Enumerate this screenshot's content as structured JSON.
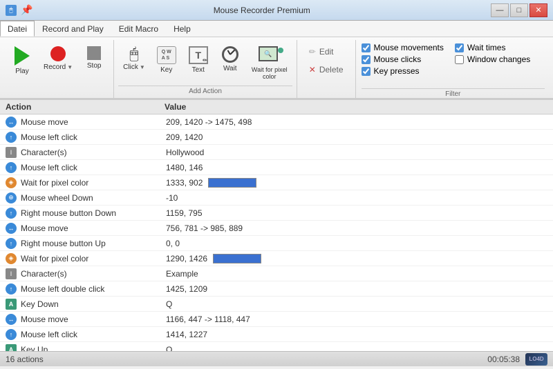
{
  "title": "Mouse Recorder Premium",
  "titlebar": {
    "icon": "🖱",
    "minimize": "—",
    "maximize": "□",
    "close": "✕"
  },
  "menu": {
    "items": [
      "Datei",
      "Record and Play",
      "Edit Macro",
      "Help"
    ],
    "active": "Datei"
  },
  "toolbar": {
    "play_label": "Play",
    "record_label": "Record",
    "stop_label": "Stop",
    "click_label": "Click",
    "key_label": "Key",
    "text_label": "Text",
    "wait_label": "Wait",
    "wait_pixel_label": "Wait for pixel color",
    "add_action_label": "Add Action",
    "edit_label": "Edit",
    "delete_label": "Delete",
    "filter_label": "Filter"
  },
  "filter": {
    "mouse_movements": {
      "label": "Mouse movements",
      "checked": true
    },
    "wait_times": {
      "label": "Wait times",
      "checked": true
    },
    "mouse_clicks": {
      "label": "Mouse clicks",
      "checked": true
    },
    "window_changes": {
      "label": "Window changes",
      "checked": false
    },
    "key_presses": {
      "label": "Key presses",
      "checked": true
    }
  },
  "table": {
    "col_action": "Action",
    "col_value": "Value",
    "rows": [
      {
        "icon_type": "blue",
        "icon_text": "↕",
        "action": "Mouse move",
        "value": "209, 1420 -> 1475, 498",
        "swatch": null
      },
      {
        "icon_type": "blue",
        "icon_text": "↕",
        "action": "Mouse left click",
        "value": "209, 1420",
        "swatch": null
      },
      {
        "icon_type": "gray-sq",
        "icon_text": "I",
        "action": "Character(s)",
        "value": "Hollywood",
        "swatch": null
      },
      {
        "icon_type": "blue",
        "icon_text": "↕",
        "action": "Mouse left click",
        "value": "1480, 146",
        "swatch": null
      },
      {
        "icon_type": "orange",
        "icon_text": "⊡",
        "action": "Wait for pixel color",
        "value": "1333, 902",
        "swatch": "#3a70d0"
      },
      {
        "icon_type": "blue",
        "icon_text": "↕",
        "action": "Mouse wheel Down",
        "value": "-10",
        "swatch": null
      },
      {
        "icon_type": "blue",
        "icon_text": "↕",
        "action": "Right mouse button Down",
        "value": "1159, 795",
        "swatch": null
      },
      {
        "icon_type": "blue",
        "icon_text": "↕",
        "action": "Mouse move",
        "value": "756, 781 -> 985, 889",
        "swatch": null
      },
      {
        "icon_type": "blue",
        "icon_text": "↕",
        "action": "Right mouse button Up",
        "value": "0, 0",
        "swatch": null
      },
      {
        "icon_type": "orange",
        "icon_text": "⊡",
        "action": "Wait for pixel color",
        "value": "1290, 1426",
        "swatch": "#3a70d0"
      },
      {
        "icon_type": "gray-sq",
        "icon_text": "I",
        "action": "Character(s)",
        "value": "Example",
        "swatch": null
      },
      {
        "icon_type": "blue",
        "icon_text": "↕",
        "action": "Mouse left double click",
        "value": "1425, 1209",
        "swatch": null
      },
      {
        "icon_type": "green-a",
        "icon_text": "A",
        "action": "Key Down",
        "value": "Q",
        "swatch": null
      },
      {
        "icon_type": "blue",
        "icon_text": "↕",
        "action": "Mouse move",
        "value": "1166, 447 -> 1118, 447",
        "swatch": null
      },
      {
        "icon_type": "blue",
        "icon_text": "↕",
        "action": "Mouse left click",
        "value": "1414, 1227",
        "swatch": null
      },
      {
        "icon_type": "green-a",
        "icon_text": "A",
        "action": "Key Up",
        "value": "Q",
        "swatch": null
      }
    ]
  },
  "status": {
    "actions_count": "16 actions",
    "time": "00:05:38"
  }
}
